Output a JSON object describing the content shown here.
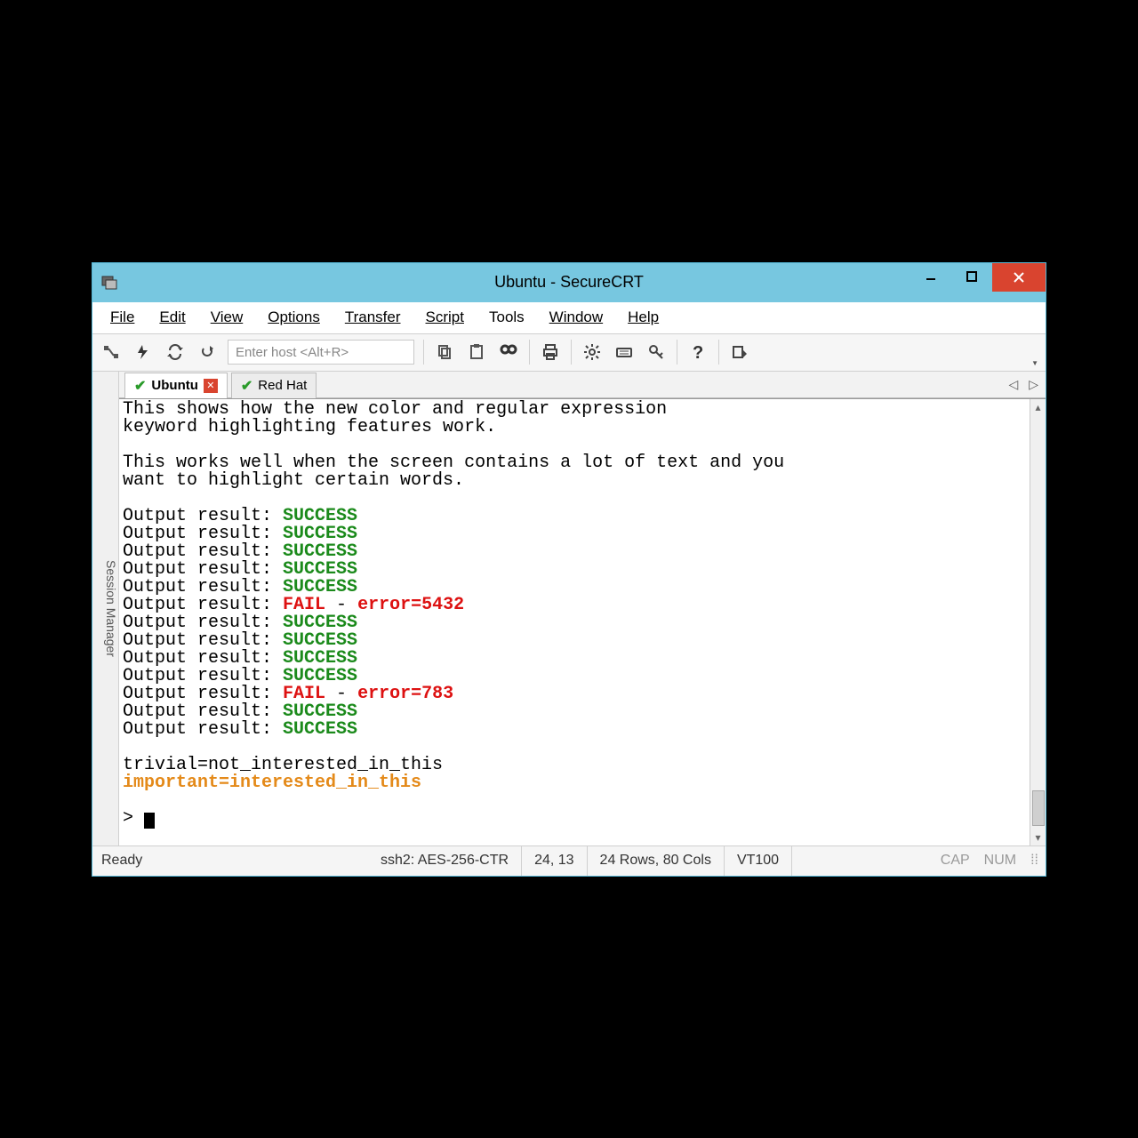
{
  "window": {
    "title": "Ubuntu - SecureCRT"
  },
  "menu": {
    "file": "File",
    "edit": "Edit",
    "view": "View",
    "options": "Options",
    "transfer": "Transfer",
    "script": "Script",
    "tools": "Tools",
    "window": "Window",
    "help": "Help"
  },
  "toolbar": {
    "host_placeholder": "Enter host <Alt+R>"
  },
  "sidebar": {
    "session_manager": "Session Manager"
  },
  "tabs": {
    "ubuntu": "Ubuntu",
    "redhat": "Red Hat"
  },
  "terminal": {
    "intro1": "This shows how the new color and regular expression",
    "intro2": "keyword highlighting features work.",
    "intro3": "This works well when the screen contains a lot of text and you",
    "intro4": "want to highlight certain words.",
    "out_prefix": "Output result: ",
    "success": "SUCCESS",
    "fail": "FAIL",
    "sep": " - ",
    "err1": "error=5432",
    "err2": "error=783",
    "trivial": "trivial=not_interested_in_this",
    "important": "important=interested_in_this",
    "prompt": "> "
  },
  "status": {
    "ready": "Ready",
    "proto": "ssh2: AES-256-CTR",
    "pos": "24,  13",
    "size": "24 Rows, 80 Cols",
    "term": "VT100",
    "cap": "CAP",
    "num": "NUM"
  }
}
